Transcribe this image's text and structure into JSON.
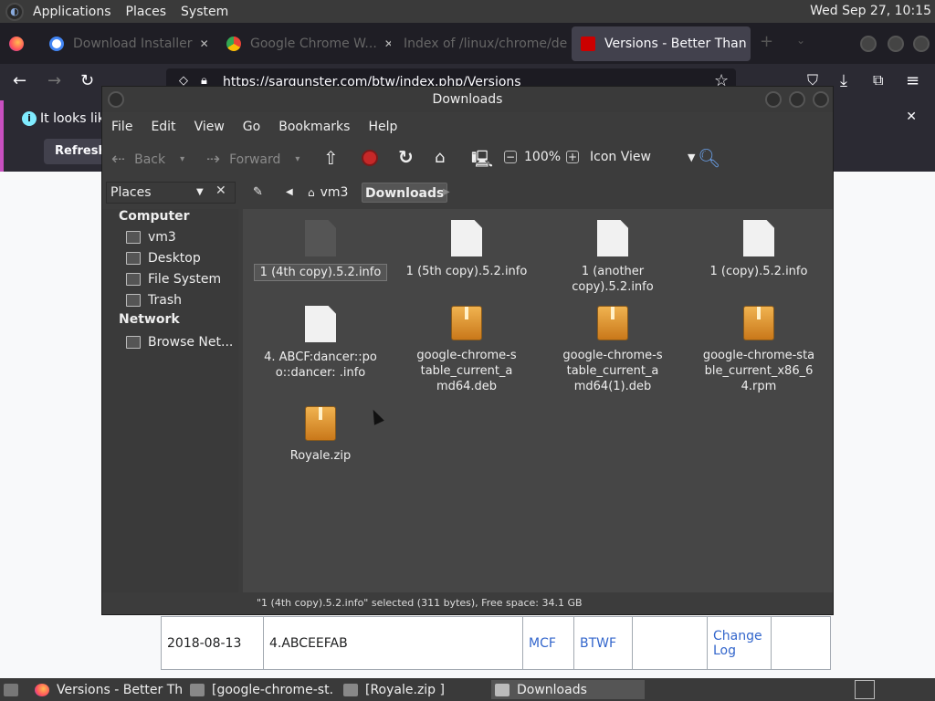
{
  "top_panel": {
    "applications": "Applications",
    "places": "Places",
    "system": "System",
    "clock": "Wed Sep 27, 10:15"
  },
  "firefox": {
    "tabs": [
      {
        "label": "Download Installer"
      },
      {
        "label": "Google Chrome W..."
      },
      {
        "label": "Index of /linux/chrome/deb..."
      },
      {
        "label": "Versions - Better Than"
      }
    ],
    "url": "https://sargunster.com/btw/index.php/Versions",
    "notification": {
      "text": "It looks like",
      "button": "Refresh Fi"
    },
    "table_row": {
      "date": "2018-08-13",
      "version": "4.ABCEEFAB",
      "link1": "MCF",
      "link2": "BTWF",
      "changelog": "Change Log"
    }
  },
  "nautilus": {
    "title": "Downloads",
    "menu": [
      "File",
      "Edit",
      "View",
      "Go",
      "Bookmarks",
      "Help"
    ],
    "toolbar": {
      "back": "Back",
      "forward": "Forward",
      "zoom": "100%",
      "view_mode": "Icon View"
    },
    "places_label": "Places",
    "breadcrumb": [
      "vm3",
      "Downloads"
    ],
    "sidebar": {
      "computer_heading": "Computer",
      "computer_items": [
        "vm3",
        "Desktop",
        "File System",
        "Trash"
      ],
      "network_heading": "Network",
      "network_items": [
        "Browse Net..."
      ]
    },
    "files": [
      {
        "name": "1 (4th copy).5.2.info",
        "type": "doc",
        "selected": true
      },
      {
        "name": "1 (5th copy).5.2.info",
        "type": "doc"
      },
      {
        "name": "1 (another copy).5.2.info",
        "type": "doc"
      },
      {
        "name": "1 (copy).5.2.info",
        "type": "doc"
      },
      {
        "name": "4. ABCF:dancer::poo::dancer: .info",
        "type": "doc"
      },
      {
        "name": "google-chrome-stable_current_amd64.deb",
        "type": "pkg"
      },
      {
        "name": "google-chrome-stable_current_amd64(1).deb",
        "type": "pkg"
      },
      {
        "name": "google-chrome-stable_current_x86_64.rpm",
        "type": "pkg"
      },
      {
        "name": "Royale.zip",
        "type": "pkg"
      }
    ],
    "status": "\"1 (4th copy).5.2.info\" selected (311 bytes), Free space: 34.1 GB"
  },
  "taskbar": {
    "items": [
      {
        "label": "Versions - Better Th..."
      },
      {
        "label": "[google-chrome-st..."
      },
      {
        "label": "[Royale.zip ]"
      },
      {
        "label": "Downloads"
      }
    ]
  }
}
